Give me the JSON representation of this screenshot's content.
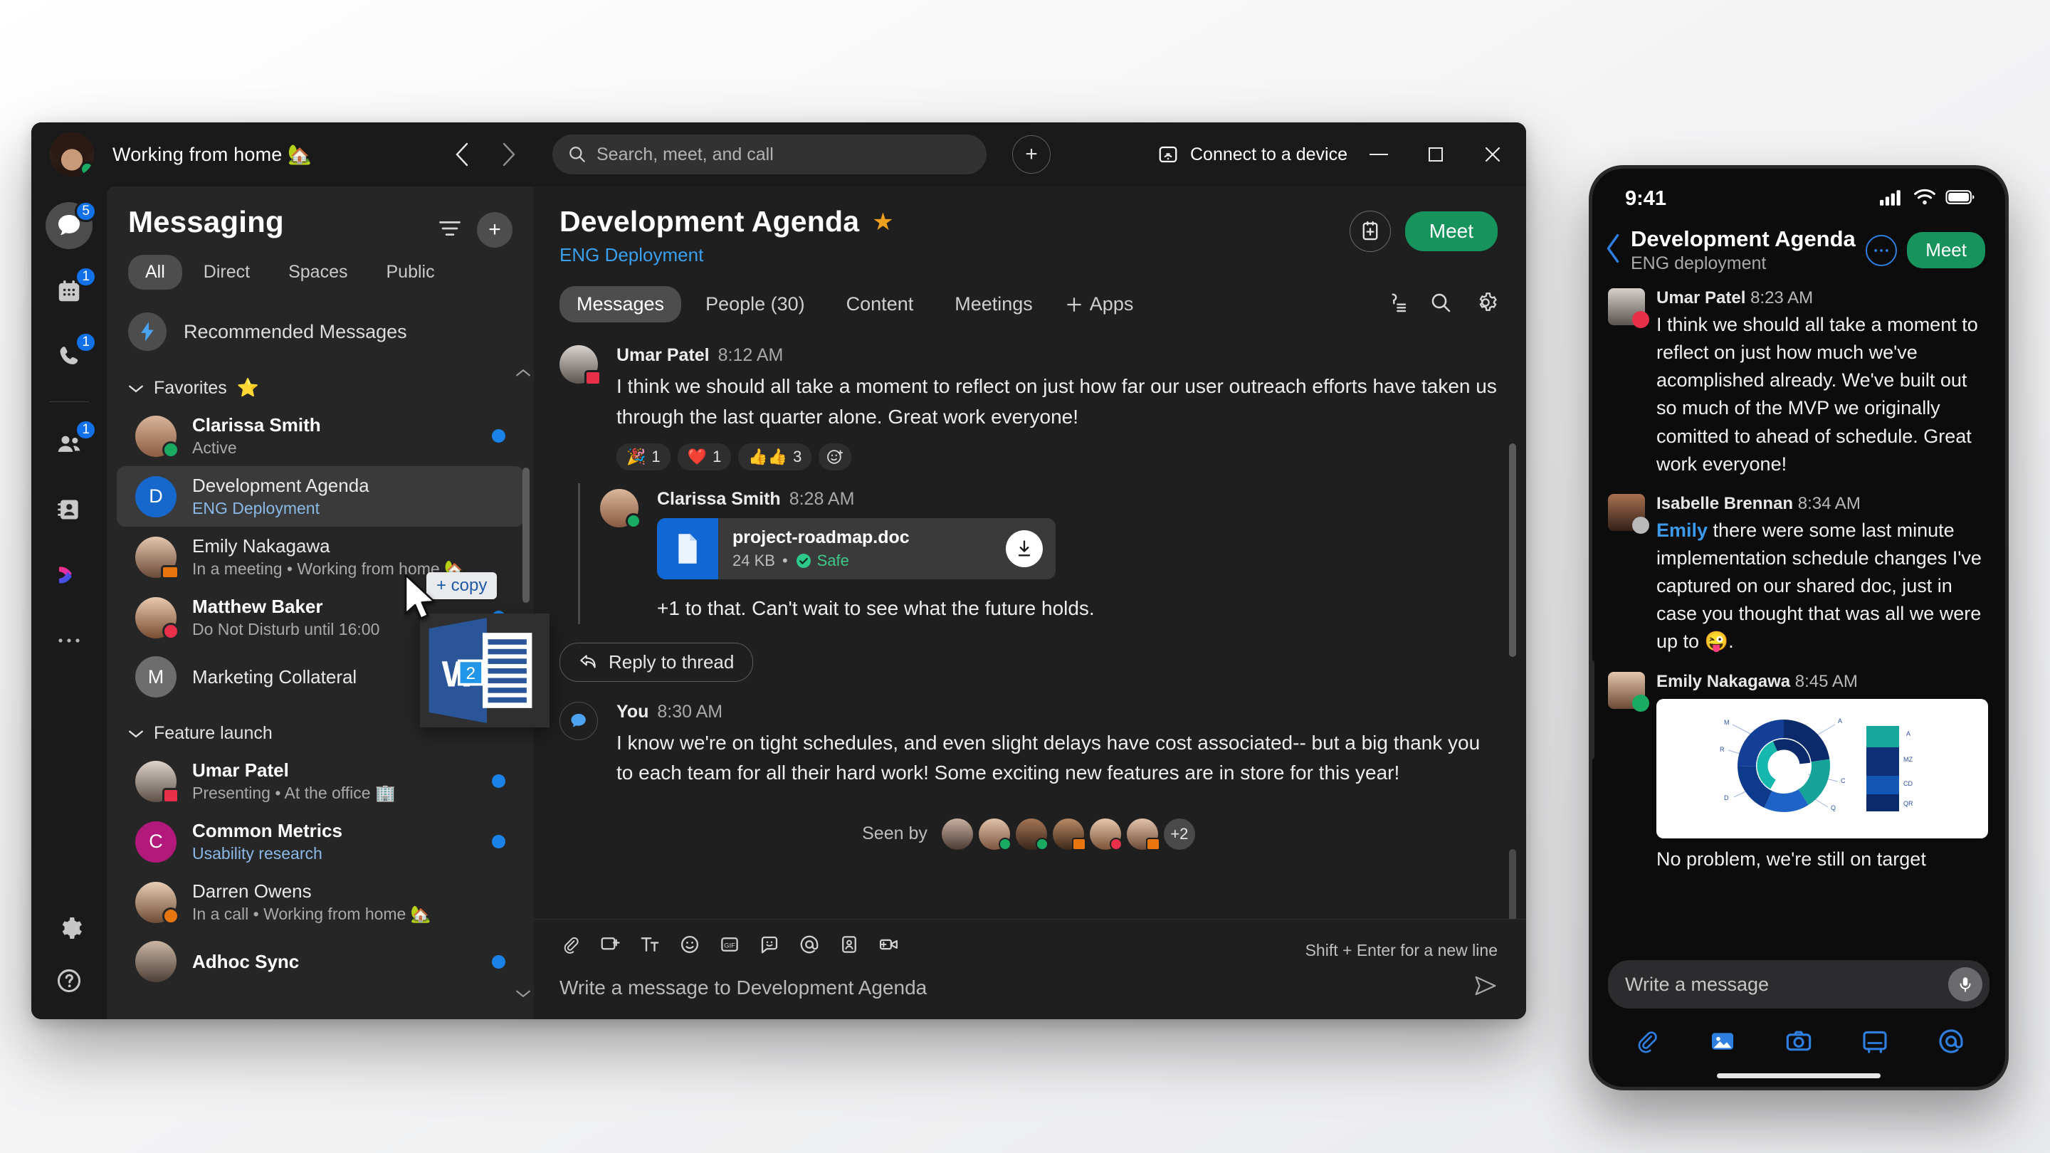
{
  "desktop": {
    "titlebar": {
      "status_text": "Working from home 🏡",
      "back_icon": "chevron-left-icon",
      "forward_icon": "chevron-right-icon",
      "search_placeholder": "Search, meet, and call",
      "plus_label": "+",
      "connect_label": "Connect to a device",
      "minimize_label": "—",
      "maximize_label": "▢",
      "close_label": "✕"
    },
    "rail": {
      "items": [
        {
          "name": "messaging",
          "icon": "chat-bubble-icon",
          "badge": "5",
          "active": true
        },
        {
          "name": "calendar",
          "icon": "calendar-icon",
          "badge": "1",
          "active": false
        },
        {
          "name": "calling",
          "icon": "phone-icon",
          "badge": "1",
          "active": false
        },
        {
          "name": "teams",
          "icon": "people-icon",
          "badge": "1",
          "active": false
        },
        {
          "name": "contacts",
          "icon": "contact-card-icon",
          "badge": "",
          "active": false
        },
        {
          "name": "webex-apps",
          "icon": "webex-logo-icon",
          "badge": "",
          "active": false
        },
        {
          "name": "more",
          "icon": "ellipsis-icon",
          "badge": "",
          "active": false
        }
      ],
      "settings_icon": "gear-icon",
      "help_icon": "question-circle-icon"
    },
    "list_panel": {
      "title": "Messaging",
      "filter_icon": "filter-icon",
      "add_label": "+",
      "chips": [
        {
          "label": "All",
          "selected": true
        },
        {
          "label": "Direct",
          "selected": false
        },
        {
          "label": "Spaces",
          "selected": false
        },
        {
          "label": "Public",
          "selected": false
        }
      ],
      "recommended_label": "Recommended Messages",
      "groups": [
        {
          "title": "Favorites",
          "emoji": "⭐",
          "items": [
            {
              "name": "Clarissa Smith",
              "sub": "Active",
              "sub_style": "normal",
              "unread": true,
              "dot": true,
              "avatar": "photo-woman-1",
              "presence": "active",
              "selected": false,
              "mute": false
            },
            {
              "name": "Development Agenda",
              "sub": "ENG Deployment",
              "sub_style": "accent",
              "unread": false,
              "dot": false,
              "avatar": "initial-D",
              "presence": "none",
              "selected": true,
              "mute": false
            },
            {
              "name": "Emily Nakagawa",
              "sub": "In a meeting • Working from home 🏡",
              "sub_style": "normal",
              "unread": false,
              "dot": false,
              "avatar": "photo-woman-2",
              "presence": "meeting",
              "selected": false,
              "mute": false
            },
            {
              "name": "Matthew Baker",
              "sub": "Do Not Disturb until 16:00",
              "sub_style": "normal",
              "unread": true,
              "dot": true,
              "avatar": "photo-man-1",
              "presence": "dnd",
              "selected": false,
              "mute": false
            },
            {
              "name": "Marketing Collateral",
              "sub": "",
              "sub_style": "normal",
              "unread": false,
              "dot": false,
              "avatar": "initial-M",
              "presence": "none",
              "selected": false,
              "mute": true
            }
          ]
        },
        {
          "title": "Feature launch",
          "emoji": "",
          "items": [
            {
              "name": "Umar Patel",
              "sub": "Presenting • At the office 🏢",
              "sub_style": "normal",
              "unread": true,
              "dot": true,
              "avatar": "photo-man-2",
              "presence": "presenting",
              "selected": false,
              "mute": false
            },
            {
              "name": "Common Metrics",
              "sub": "Usability research",
              "sub_style": "accent",
              "unread": true,
              "dot": true,
              "avatar": "initial-C",
              "presence": "none",
              "selected": false,
              "mute": false
            },
            {
              "name": "Darren Owens",
              "sub": "In a call • Working from home 🏡",
              "sub_style": "normal",
              "unread": false,
              "dot": false,
              "avatar": "photo-man-3",
              "presence": "call",
              "selected": false,
              "mute": false
            },
            {
              "name": "Adhoc Sync",
              "sub": "",
              "sub_style": "normal",
              "unread": true,
              "dot": true,
              "avatar": "photo-woman-3",
              "presence": "none",
              "selected": false,
              "mute": false
            }
          ]
        }
      ]
    },
    "chat": {
      "title": "Development Agenda",
      "favorite_icon": "star-icon",
      "subtitle": "ENG Deployment",
      "schedule_icon": "add-to-calendar-icon",
      "meet_label": "Meet",
      "tabs": [
        {
          "label": "Messages",
          "selected": true
        },
        {
          "label": "People (30)",
          "selected": false
        },
        {
          "label": "Content",
          "selected": false
        },
        {
          "label": "Meetings",
          "selected": false
        }
      ],
      "apps_label": "Apps",
      "tab_right_icons": [
        "pin-list-icon",
        "search-icon",
        "gear-icon"
      ],
      "messages": [
        {
          "author": "Umar Patel",
          "time": "8:12 AM",
          "text": "I think we should all take a moment to reflect on just how far our user outreach efforts have taken us through the last quarter alone. Great work everyone!",
          "reactions": [
            {
              "emoji": "🎉",
              "count": "1"
            },
            {
              "emoji": "❤️",
              "count": "1"
            },
            {
              "emoji": "👍👍",
              "count": "3"
            }
          ],
          "add_reaction_icon": "add-reaction-icon"
        }
      ],
      "thread": {
        "author": "Clarissa Smith",
        "time": "8:28 AM",
        "file": {
          "name": "project-roadmap.doc",
          "size": "24 KB",
          "separator": "•",
          "safety": "Safe",
          "file_icon": "document-icon",
          "download_icon": "download-icon"
        },
        "text": "+1 to that. Can't wait to see what the future holds.",
        "reply_label": "Reply to thread",
        "reply_icon": "reply-arrow-icon"
      },
      "own_message": {
        "author": "You",
        "time": "8:30 AM",
        "text": "I know we're on tight schedules, and even slight delays have cost associated-- but a big thank you to each team for all their hard work! Some exciting new features are in store for this year!"
      },
      "seen_by": {
        "label": "Seen by",
        "overflow": "+2",
        "avatars": [
          "seen-1",
          "seen-2",
          "seen-3",
          "seen-4",
          "seen-5",
          "seen-6"
        ]
      },
      "composer": {
        "tools": [
          "attachment-icon",
          "screen-share-icon",
          "format-text-icon",
          "emoji-icon",
          "gif-icon",
          "sticker-icon",
          "mention-icon",
          "contact-card-icon",
          "add-video-icon"
        ],
        "hint": "Shift + Enter for a new line",
        "placeholder": "Write a message to Development Agenda",
        "send_icon": "send-icon"
      }
    },
    "drag_overlay": {
      "copy_label": "+ copy",
      "file_badge": "2",
      "file_glyph": "W",
      "cursor_icon": "cursor-arrow-icon"
    }
  },
  "phone": {
    "status": {
      "time": "9:41",
      "signal_icon": "cellular-icon",
      "wifi_icon": "wifi-icon",
      "battery_icon": "battery-icon"
    },
    "header": {
      "back_icon": "chevron-left-icon",
      "title": "Development Agenda",
      "subtitle": "ENG deployment",
      "more_icon": "ellipsis-circle-icon",
      "meet_label": "Meet"
    },
    "messages": [
      {
        "author": "Umar Patel",
        "time": "8:23 AM",
        "text": "I think we should all take a moment to reflect on just how much we've acomplished already. We've built out so much of the MVP we originally comitted to ahead of schedule. Great work everyone!",
        "presence": "dnd"
      },
      {
        "author": "Isabelle Brennan",
        "time": "8:34 AM",
        "mention": "Emily",
        "text": " there were some last minute implementation schedule changes I've captured on our shared doc, just in case you thought that was all we were up to 😜.",
        "presence": "pending"
      },
      {
        "author": "Emily Nakagawa",
        "time": "8:45 AM",
        "text": "",
        "caption": "No problem, we're still on target",
        "presence": "active",
        "has_chart_card": true
      }
    ],
    "composer": {
      "placeholder": "Write a message",
      "mic_icon": "microphone-icon",
      "tools": [
        "attachment-icon",
        "image-icon",
        "camera-icon",
        "whiteboard-icon",
        "mention-icon"
      ]
    }
  },
  "chart_data": {
    "type": "pie",
    "title": "",
    "labels": [
      "A",
      "C",
      "Q",
      "D",
      "R",
      "M"
    ],
    "values": [
      22,
      18,
      15,
      17,
      14,
      14
    ],
    "colors": [
      "#0b2a6b",
      "#16a39a",
      "#1e64c8",
      "#0d3a8a",
      "#16b7ad",
      "#133f96"
    ],
    "legend": {
      "position": "right",
      "entries": [
        "A",
        "MZ",
        "CD",
        "QR"
      ]
    }
  }
}
